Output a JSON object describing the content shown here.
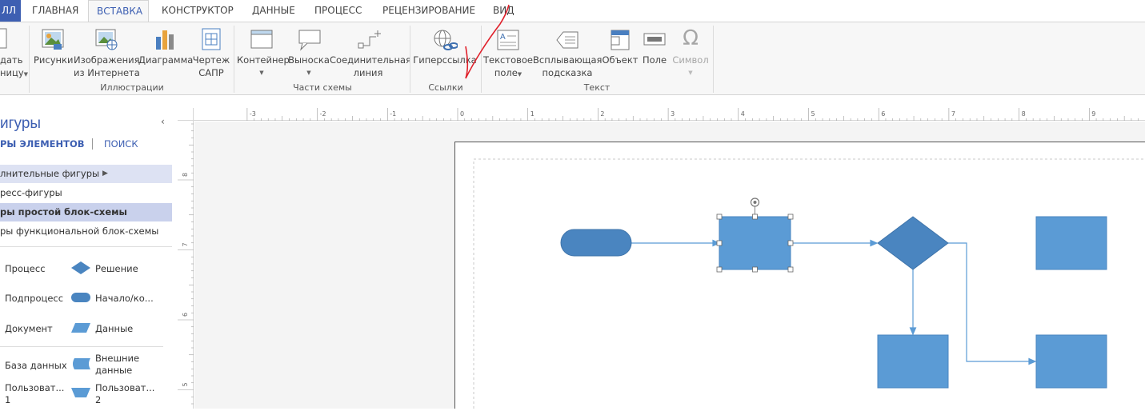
{
  "tabs": {
    "file": "ЛЛ",
    "home": "ГЛАВНАЯ",
    "insert": "ВСТАВКА",
    "design": "КОНСТРУКТОР",
    "data": "ДАННЫЕ",
    "process": "ПРОЦЕСС",
    "review": "РЕЦЕНЗИРОВАНИЕ",
    "view": "ВИД"
  },
  "ribbon": {
    "page": {
      "line1": "дать",
      "line2": "ницу"
    },
    "pictures": "Рисунки",
    "online_pictures": {
      "line1": "Изображения",
      "line2": "из Интернета"
    },
    "chart": "Диаграмма",
    "cad": {
      "line1": "Чертеж",
      "line2": "САПР"
    },
    "illustrations_group": "Иллюстрации",
    "container": "Контейнер",
    "callout": "Выноска",
    "connector": {
      "line1": "Соединительная",
      "line2": "линия"
    },
    "diagram_parts_group": "Части схемы",
    "hyperlink": "Гиперссылка",
    "links_group": "Ссылки",
    "text_box": {
      "line1": "Текстовое",
      "line2": "поле"
    },
    "screentip": {
      "line1": "Всплывающая",
      "line2": "подсказка"
    },
    "object": "Объект",
    "field": "Поле",
    "symbol": "Символ",
    "text_group": "Текст"
  },
  "shapes_panel": {
    "title": "игуры",
    "tab_stencils": "РЫ ЭЛЕМЕНТОВ",
    "tab_search": "ПОИСК",
    "stencils": [
      "лнительные фигуры",
      "ресс-фигуры",
      "ры простой блок-схемы",
      "ры функциональной блок-схемы"
    ],
    "shapes": {
      "process": "Процесс",
      "decision": "Решение",
      "subprocess": "Подпроцесс",
      "start_end": "Начало/ко...",
      "document": "Документ",
      "data": "Данные",
      "database": "База данных",
      "external_data": {
        "line1": "Внешние",
        "line2": "данные"
      },
      "custom1": {
        "line1": "Пользоват...",
        "line2": "1"
      },
      "custom2": {
        "line1": "Пользоват...",
        "line2": "2"
      }
    }
  },
  "ruler": {
    "h_ticks": [
      "-3",
      "-2",
      "-1",
      "0",
      "1",
      "2",
      "3",
      "4",
      "5",
      "6",
      "7",
      "8",
      "9"
    ],
    "v_ticks": [
      "8",
      "7",
      "6",
      "5"
    ]
  },
  "colors": {
    "accent": "#3d5fb2",
    "shape_fill": "#5b9bd5",
    "shape_dark": "#4a85c0",
    "connector": "#5b9bd5",
    "annotation": "#e0202a"
  }
}
